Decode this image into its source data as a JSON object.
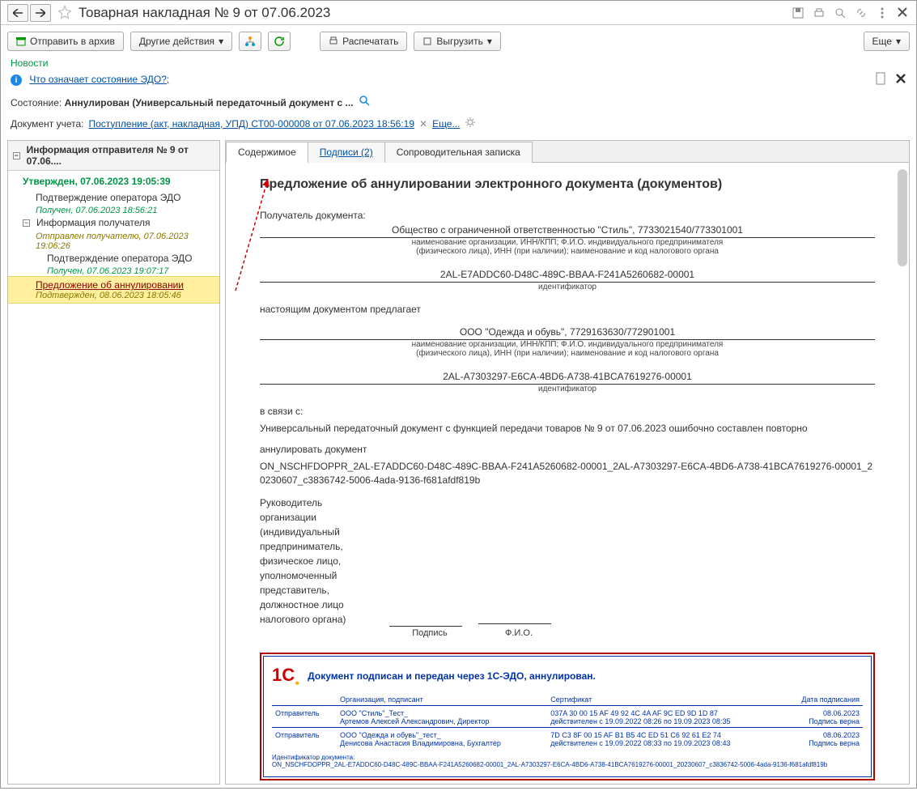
{
  "title": "Товарная накладная № 9 от 07.06.2023",
  "toolbar": {
    "archive": "Отправить в архив",
    "other": "Другие действия",
    "print": "Распечатать",
    "export": "Выгрузить",
    "more": "Еще"
  },
  "news": {
    "header": "Новости",
    "link": "Что означает состояние ЭДО?;"
  },
  "state": {
    "label": "Состояние:",
    "value": "Аннулирован (Универсальный передаточный документ с ..."
  },
  "docref": {
    "label": "Документ учета:",
    "link": "Поступление (акт, накладная, УПД) СТ00-000008 от 07.06.2023 18:56:19",
    "more": "Еще..."
  },
  "tree": {
    "header": "Информация отправителя № 9 от 07.06....",
    "approved": "Утвержден, 07.06.2023 19:05:39",
    "i1": "Подтверждение оператора ЭДО",
    "i1s": "Получен, 07.06.2023 18:56:21",
    "i2": "Информация получателя",
    "i2s": "Отправлен получателю, 07.06.2023 19:06:26",
    "i3": "Подтверждение оператора ЭДО",
    "i3s": "Получен, 07.06.2023 19:07:17",
    "sel": "Предложение об аннулировании",
    "sels": "Подтвержден, 08.06.2023 18:05:46"
  },
  "tabs": {
    "t1": "Содержимое",
    "t2": "Подписи (2)",
    "t3": "Сопроводительная записка"
  },
  "doc": {
    "title": "Предложение об аннулировании электронного документа (документов)",
    "recipient_label": "Получатель документа:",
    "recipient_val": "Общество с ограниченной ответственностью \"Стиль\", 7733021540/773301001",
    "org_cap1": "наименование организации, ИНН/КПП; Ф.И.О. индивидуального предпринимателя",
    "org_cap2": "(физического лица), ИНН (при наличии); наименование и код налогового органа",
    "id1": "2AL-E7ADDC60-D48C-489C-BBAA-F241A5260682-00001",
    "id_cap": "идентификатор",
    "offers": "настоящим документом предлагает",
    "sender_val": "ООО \"Одежда и обувь\", 7729163630/772901001",
    "id2": "2AL-A7303297-E6CA-4BD6-A738-41BCA7619276-00001",
    "reason_label": "в связи с:",
    "reason": "Универсальный передаточный документ с функцией передачи товаров № 9 от 07.06.2023 ошибочно составлен повторно",
    "annul_label": "аннулировать документ",
    "annul_file": "ON_NSCHFDOPPR_2AL-E7ADDC60-D48C-489C-BBAA-F241A5260682-00001_2AL-A7303297-E6CA-4BD6-A738-41BCA7619276-00001_20230607_c3836742-5006-4ada-9136-f681afdf819b",
    "signer": "Руководитель организации (индивидуальный предприниматель, физическое лицо, уполномоченный представитель, должностное лицо налогового органа)",
    "podpis": "Подпись",
    "fio": "Ф.И.О."
  },
  "stamp": {
    "title": "Документ подписан и передан через 1С-ЭДО, аннулирован.",
    "h_org": "Организация, подписант",
    "h_cert": "Сертификат",
    "h_date": "Дата подписания",
    "row1_role": "Отправитель",
    "row1_org": "ООО \"Стиль\"_Тест_",
    "row1_person": "Артемов Алексей Александрович, Директор",
    "row1_cert": "037A 30 00 15 AF 49 92 4C 4A AF 9C ED 9D 1D 87",
    "row1_valid": "действителен с 19.09.2022 08:26 по 19.09.2023 08:35",
    "row1_date": "08.06.2023",
    "row1_ok": "Подпись верна",
    "row2_role": "Отправитель",
    "row2_org": "ООО \"Одежда и обувь\"_тест_",
    "row2_person": "Денисова Анастасия Владимировна, Бухгалтер",
    "row2_cert": "7D C3 8F 00 15 AF B1 B5 4C ED 51 C6 92 61 E2 74",
    "row2_valid": "действителен с 19.09.2022 08:33 по 19.09.2023 08:43",
    "row2_date": "08.06.2023",
    "row2_ok": "Подпись верна",
    "doc_id_label": "Идентификатор документа:",
    "doc_id": "ON_NSCHFDOPPR_2AL-E7ADDC60-D48C-489C-BBAA-F241A5260682-00001_2AL-A7303297-E6CA-4BD6-A738-41BCA7619276-00001_20230607_c3836742-5006-4ada-9136-f681afdf819b"
  }
}
